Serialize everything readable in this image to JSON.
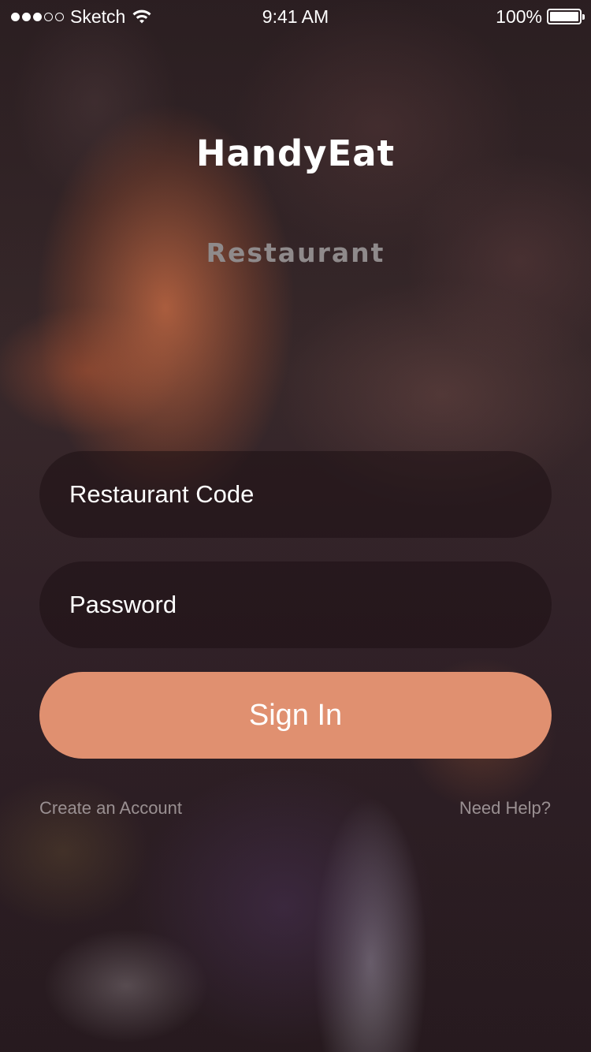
{
  "status_bar": {
    "carrier": "Sketch",
    "signal_filled": 3,
    "signal_total": 5,
    "time": "9:41 AM",
    "battery": "100%",
    "battery_level": 1.0,
    "icons": [
      "wifi-icon",
      "battery-icon"
    ]
  },
  "header": {
    "title": "HandyEat",
    "subtitle": "Restaurant"
  },
  "form": {
    "code_placeholder": "Restaurant Code",
    "password_placeholder": "Password",
    "signin_label": "Sign In"
  },
  "links": {
    "create_account": "Create an Account",
    "need_help": "Need Help?"
  },
  "colors": {
    "accent": "#e09070",
    "background": "#2b1d20",
    "link_text": "#9a9092",
    "subtitle_text": "#8f8a8b"
  }
}
